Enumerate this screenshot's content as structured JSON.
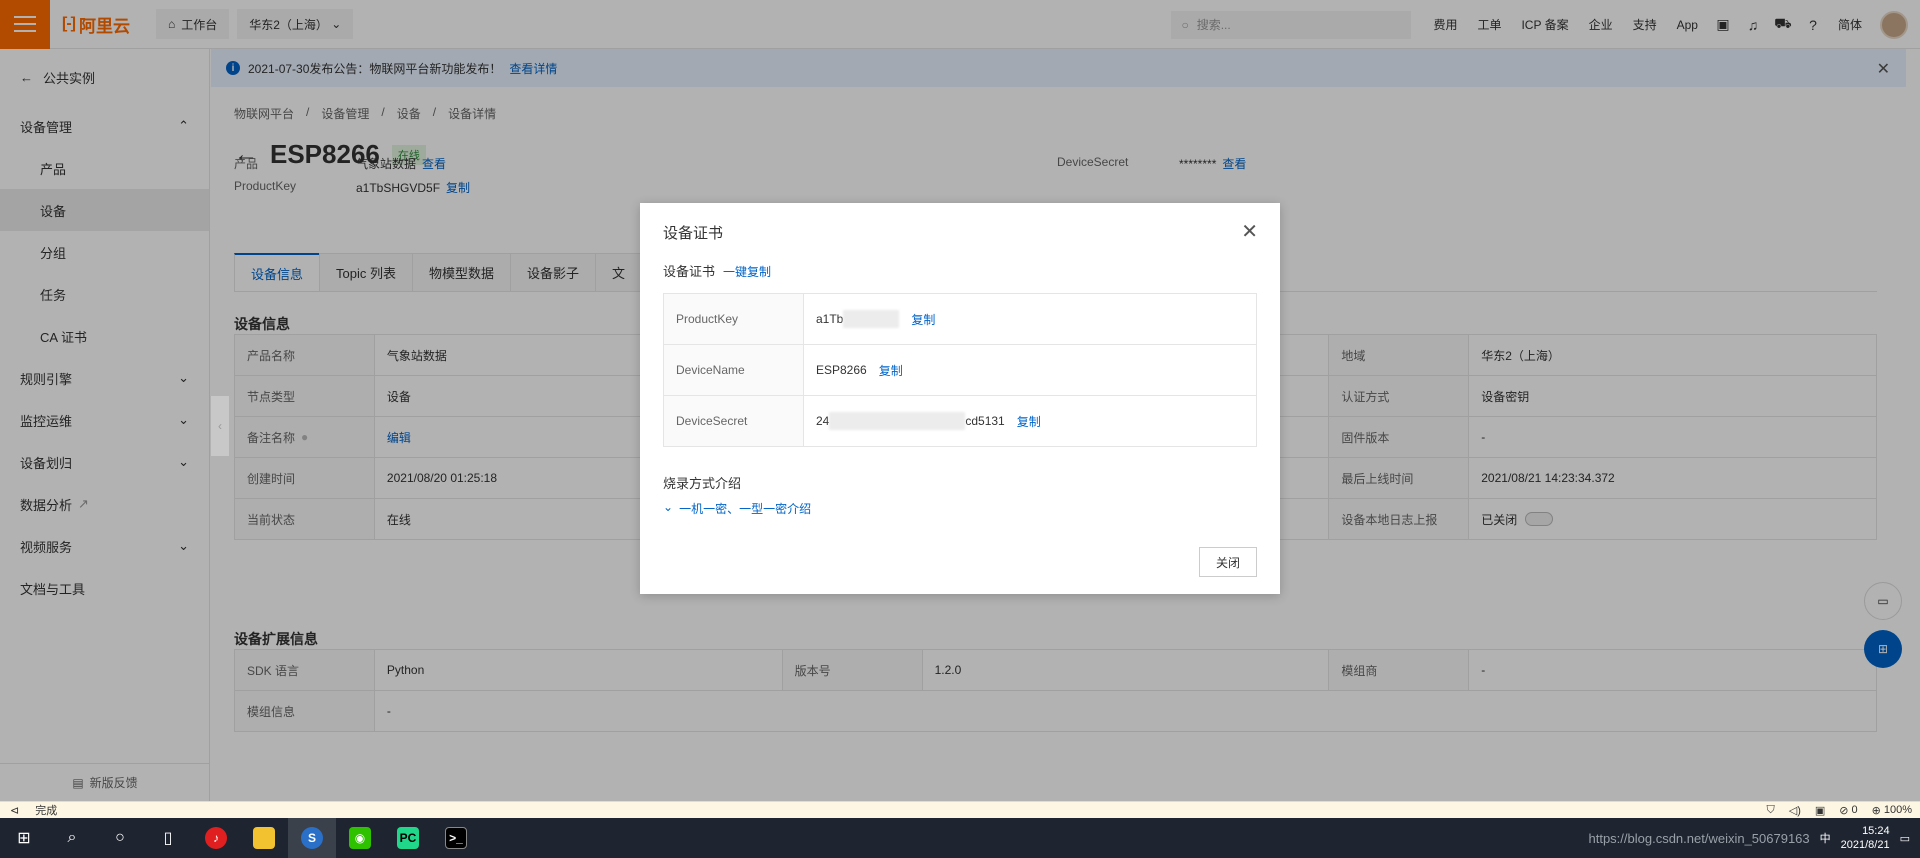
{
  "topbar": {
    "logo": "阿里云",
    "workbench": "工作台",
    "region": "华东2（上海）",
    "search_placeholder": "搜索...",
    "links": [
      "费用",
      "工单",
      "ICP 备案",
      "企业",
      "支持",
      "App"
    ],
    "lang": "简体"
  },
  "sidebar": {
    "back": "公共实例",
    "group_device": "设备管理",
    "items": [
      "产品",
      "设备",
      "分组",
      "任务",
      "CA 证书"
    ],
    "groups": [
      "规则引擎",
      "监控运维",
      "设备划归",
      "数据分析",
      "视频服务",
      "文档与工具"
    ],
    "feedback": "新版反馈"
  },
  "notice": {
    "text": "2021-07-30发布公告：物联网平台新功能发布！",
    "link": "查看详情"
  },
  "breadcrumb": [
    "物联网平台",
    "设备管理",
    "设备",
    "设备详情"
  ],
  "device": {
    "name": "ESP8266",
    "status": "在线",
    "product_label": "产品",
    "product_value": "气象站数据",
    "view": "查看",
    "pk_label": "ProductKey",
    "pk_value": "a1TbSHGVD5F",
    "copy": "复制",
    "ds_label": "DeviceSecret",
    "ds_value": "********",
    "ds_view": "查看"
  },
  "tabs": [
    "设备信息",
    "Topic 列表",
    "物模型数据",
    "设备影子",
    "文"
  ],
  "info": {
    "title": "设备信息",
    "rows": [
      {
        "k1": "产品名称",
        "v1": "气象站数据",
        "k3": "地域",
        "v3": "华东2（上海）"
      },
      {
        "k1": "节点类型",
        "v1": "设备",
        "k3": "认证方式",
        "v3": "设备密钥"
      },
      {
        "k1": "备注名称",
        "v1": "编辑",
        "k3": "固件版本",
        "v3": "-"
      },
      {
        "k1": "创建时间",
        "v1": "2021/08/20 01:25:18",
        "k3": "最后上线时间",
        "v3": "2021/08/21 14:23:34.372"
      },
      {
        "k1": "当前状态",
        "v1": "在线",
        "k3": "设备本地日志上报",
        "v3": "已关闭"
      }
    ]
  },
  "ext": {
    "title": "设备扩展信息",
    "rows": [
      {
        "k1": "SDK 语言",
        "v1": "Python",
        "k2": "版本号",
        "v2": "1.2.0",
        "k3": "模组商",
        "v3": "-"
      },
      {
        "k1": "模组信息",
        "v1": "-"
      }
    ]
  },
  "dialog": {
    "title": "设备证书",
    "subtitle": "设备证书",
    "copy_all": "一键复制",
    "rows": [
      {
        "key": "ProductKey",
        "value": "a1Tb",
        "masked_tail": "",
        "copy": "复制"
      },
      {
        "key": "DeviceName",
        "value": "ESP8266",
        "masked_tail": "",
        "copy": "复制"
      },
      {
        "key": "DeviceSecret",
        "value": "24",
        "masked_tail": "cd5131",
        "copy": "复制"
      }
    ],
    "burn_title": "烧录方式介绍",
    "burn_link": "一机一密、一型一密介绍",
    "close": "关闭"
  },
  "statusbar": {
    "left": "完成",
    "zoom": "100%",
    "count": "0"
  },
  "taskbar": {
    "time": "15:24",
    "date": "2021/8/21",
    "ime": "中",
    "watermark": "https://blog.csdn.net/weixin_50679163"
  }
}
